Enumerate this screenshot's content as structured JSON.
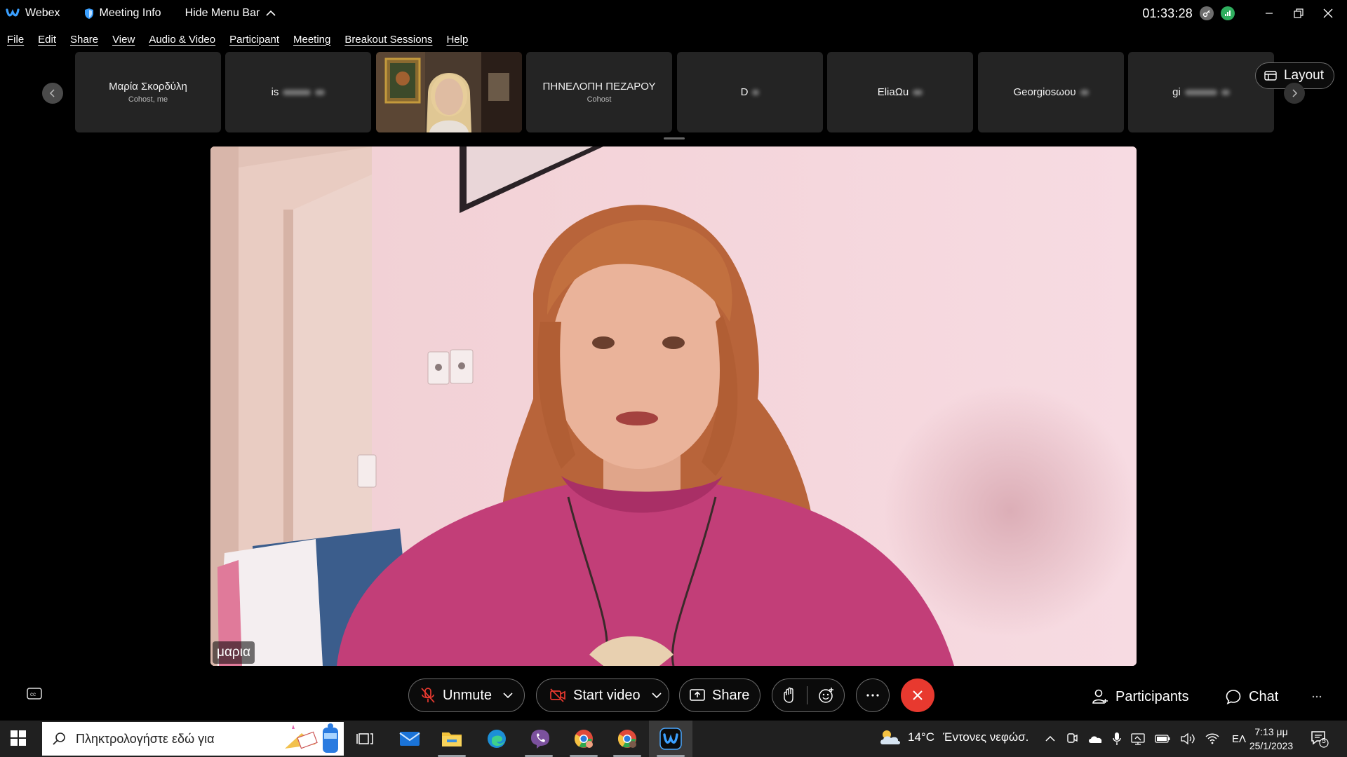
{
  "titlebar": {
    "app_name": "Webex",
    "meeting_info": "Meeting Info",
    "hide_menu": "Hide Menu Bar",
    "clock": "01:33:28"
  },
  "menu": [
    "File",
    "Edit",
    "Share",
    "View",
    "Audio & Video",
    "Participant",
    "Meeting",
    "Breakout Sessions",
    "Help"
  ],
  "filmstrip": {
    "participants": [
      {
        "name": "Μαρία Σκορδύλη",
        "sub": "Cohost, me"
      },
      {
        "name": "is",
        "sub": ""
      },
      {
        "name": "",
        "sub": ""
      },
      {
        "name": "ΠΗΝΕΛΟΠΗ ΠΕΖΑΡΟΥ",
        "sub": "Cohost"
      },
      {
        "name": "D",
        "sub": ""
      },
      {
        "name": "EliaΩu",
        "sub": ""
      },
      {
        "name": "Georgiosωου",
        "sub": ""
      },
      {
        "name": "gi",
        "sub": ""
      }
    ],
    "layout_label": "Layout"
  },
  "main_video": {
    "name_label": "μαρια"
  },
  "controls": {
    "unmute": "Unmute",
    "start_video": "Start video",
    "share": "Share",
    "participants": "Participants",
    "chat": "Chat"
  },
  "taskbar": {
    "search_placeholder": "Πληκτρολογήστε εδώ για",
    "weather_temp": "14°C",
    "weather_desc": "Έντονες νεφώσ.",
    "lang": "ΕΛ",
    "time": "7:13 μμ",
    "date": "25/1/2023",
    "notifications": "5"
  },
  "colors": {
    "accent_red": "#e8392f",
    "webex_blue": "#3ba0ff",
    "tile_bg": "#242424"
  }
}
